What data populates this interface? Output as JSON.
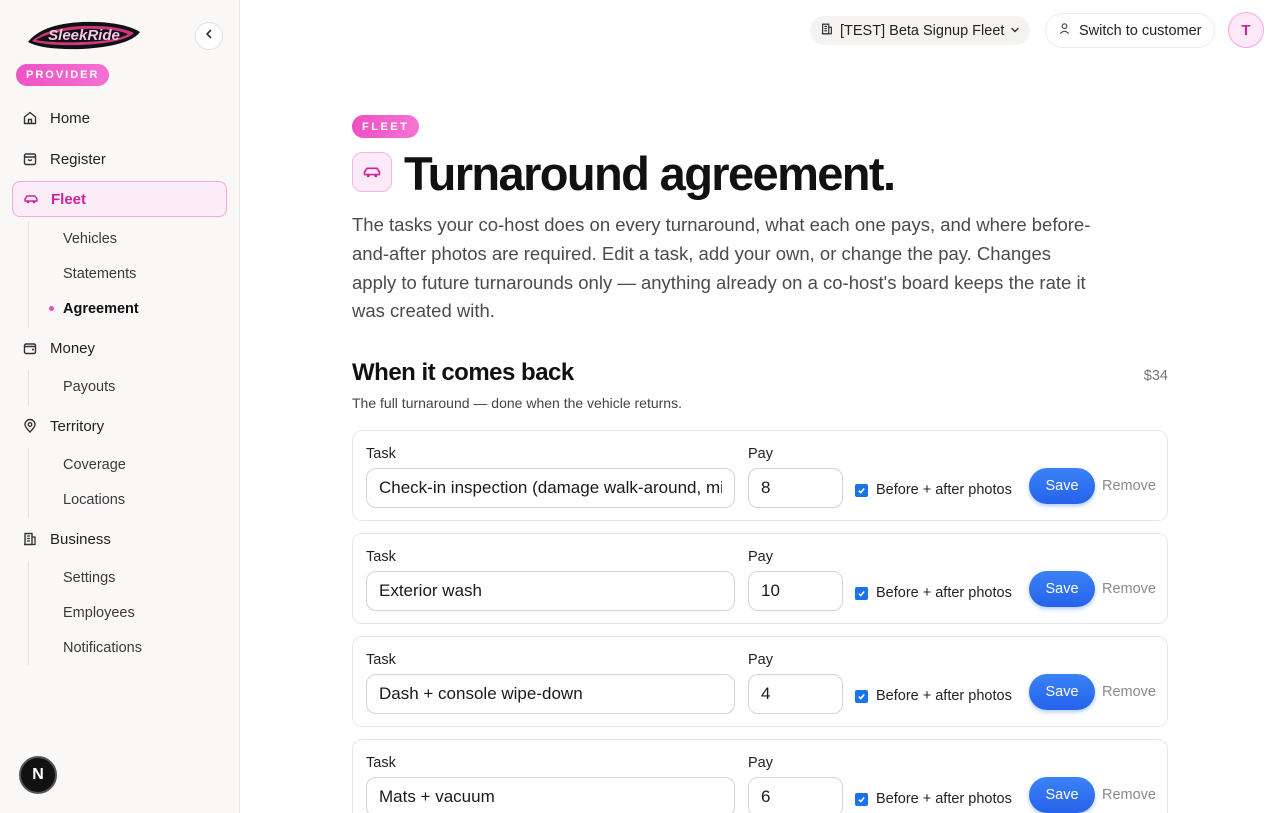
{
  "brand": {
    "logo_text": "SleekRide",
    "role_badge": "PROVIDER"
  },
  "sidebar": {
    "nav": [
      {
        "label": "Home",
        "icon": "home-icon"
      },
      {
        "label": "Register",
        "icon": "register-icon"
      },
      {
        "label": "Fleet",
        "icon": "car-icon",
        "active": true
      },
      {
        "label": "Money",
        "icon": "wallet-icon"
      },
      {
        "label": "Territory",
        "icon": "map-pin-icon"
      },
      {
        "label": "Business",
        "icon": "building-icon"
      }
    ],
    "fleet_sub": [
      "Vehicles",
      "Statements",
      "Agreement"
    ],
    "money_sub": [
      "Payouts"
    ],
    "territory_sub": [
      "Coverage",
      "Locations"
    ],
    "business_sub": [
      "Settings",
      "Employees",
      "Notifications"
    ],
    "bottom_badge": "N"
  },
  "topbar": {
    "fleet_name": "[TEST] Beta Signup Fleet",
    "switch_label": "Switch to customer",
    "avatar_initial": "T"
  },
  "page": {
    "tag": "FLEET",
    "title": "Turnaround agreement.",
    "intro": "The tasks your co-host does on every turnaround, what each one pays, and where before-and-after photos are required. Edit a task, add your own, or change the pay. Changes apply to future turnarounds only — anything already on a co-host's board keeps the rate it was created with."
  },
  "section": {
    "title": "When it comes back",
    "total": "$34",
    "subtitle": "The full turnaround — done when the vehicle returns.",
    "labels": {
      "task": "Task",
      "pay": "Pay",
      "photos": "Before + after photos",
      "save": "Save",
      "remove": "Remove"
    },
    "tasks": [
      {
        "name": "Check-in inspection (damage walk-around, mileage, fuel)",
        "pay": "8",
        "photos": true
      },
      {
        "name": "Exterior wash",
        "pay": "10",
        "photos": true
      },
      {
        "name": "Dash + console wipe-down",
        "pay": "4",
        "photos": true
      },
      {
        "name": "Mats + vacuum",
        "pay": "6",
        "photos": true
      }
    ]
  },
  "colors": {
    "accent_pink": "#ee4fc3",
    "save_blue": "#2563eb",
    "checkbox_blue": "#1a73e8"
  }
}
